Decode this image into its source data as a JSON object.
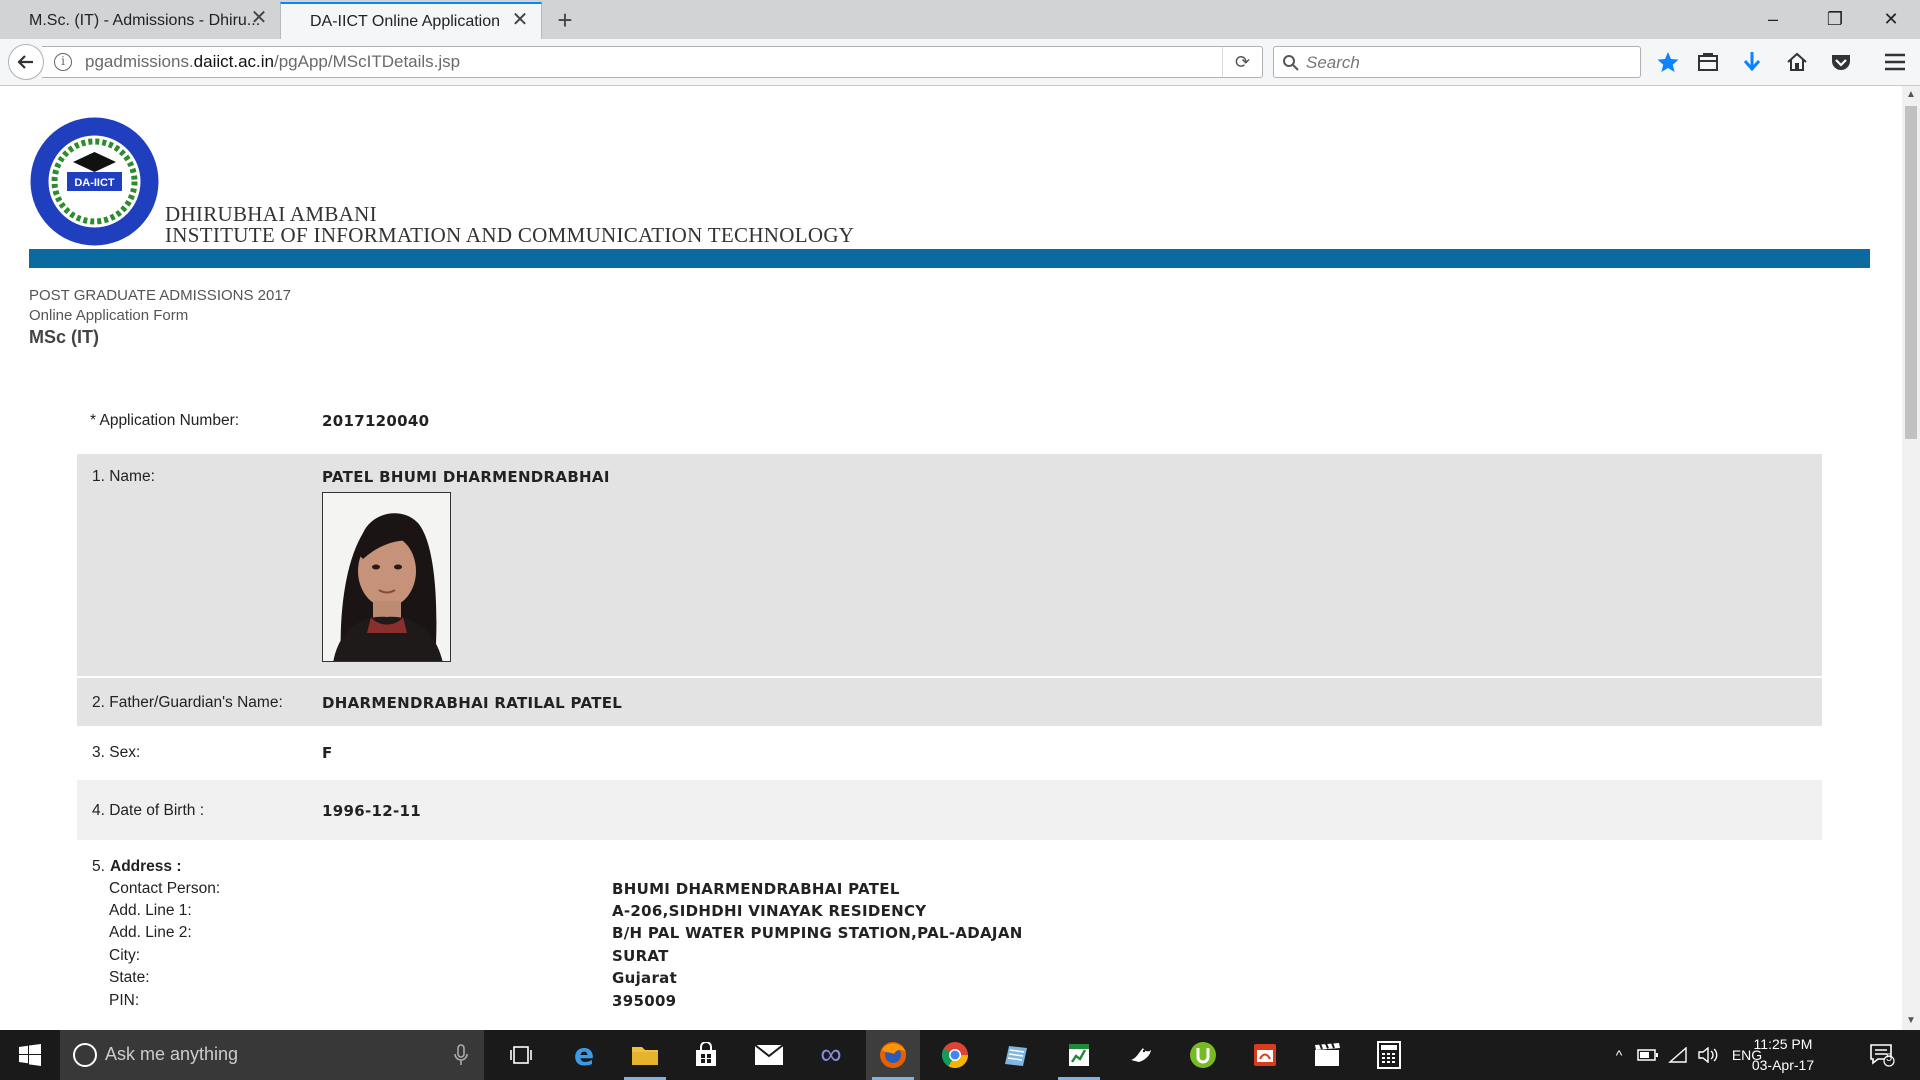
{
  "browser": {
    "tabs": [
      {
        "title": "M.Sc. (IT) - Admissions - Dhiru...",
        "active": false
      },
      {
        "title": "DA-IICT Online Application",
        "active": true
      }
    ],
    "url": {
      "prefix": "pgadmissions.",
      "domain": "daiict.ac.in",
      "path": "/pgApp/MScITDetails.jsp"
    },
    "search_placeholder": "Search"
  },
  "page": {
    "institute_line1": "DHIRUBHAI AMBANI",
    "institute_line2": "INSTITUTE OF INFORMATION AND COMMUNICATION TECHNOLOGY",
    "logo_text": "DA-IICT",
    "heading": "POST GRADUATE ADMISSIONS 2017",
    "subheading": "Online Application Form",
    "program": "MSc (IT)",
    "fields": {
      "application_number": {
        "label": "* Application Number:",
        "value": "2017120040"
      },
      "name": {
        "label": "1. Name:",
        "value": "PATEL BHUMI DHARMENDRABHAI"
      },
      "father": {
        "label": "2. Father/Guardian's Name:",
        "value": "DHARMENDRABHAI RATILAL PATEL"
      },
      "sex": {
        "label": "3. Sex:",
        "value": "F"
      },
      "dob": {
        "label": "4. Date of Birth :",
        "value": "1996-12-11"
      }
    },
    "address": {
      "number": "5.",
      "title": "Address :",
      "contact_person": {
        "label": "Contact Person:",
        "value": "BHUMI DHARMENDRABHAI PATEL"
      },
      "line1": {
        "label": "Add. Line 1:",
        "value": "A-206,SIDHDHI VINAYAK RESIDENCY"
      },
      "line2": {
        "label": "Add. Line 2:",
        "value": "B/H PAL WATER PUMPING STATION,PAL-ADAJAN"
      },
      "city": {
        "label": "City:",
        "value": "SURAT"
      },
      "state": {
        "label": "State:",
        "value": "Gujarat"
      },
      "pin": {
        "label": "PIN:",
        "value": "395009"
      }
    }
  },
  "taskbar": {
    "search_placeholder": "Ask me anything",
    "language": "ENG",
    "time": "11:25 PM",
    "date": "03-Apr-17",
    "notification_count": "5"
  },
  "colors": {
    "band": "#0b6ba1",
    "shaded_row": "#e3e3e3",
    "light_row": "#f0f0f0",
    "accent": "#0a84ff"
  }
}
